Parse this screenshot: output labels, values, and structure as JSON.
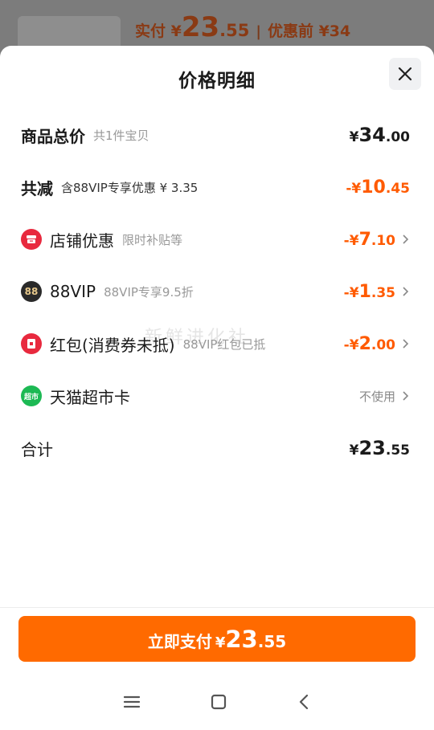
{
  "background": {
    "pay_label": "实付 ¥",
    "pay_int": "23",
    "pay_dec": ".55",
    "separator": "|",
    "before_label": "优惠前 ¥34"
  },
  "sheet": {
    "title": "价格明细"
  },
  "rows": {
    "total": {
      "label": "商品总价",
      "sub": "共1件宝贝",
      "cur": "¥",
      "int": "34",
      "dec": ".00"
    },
    "reduce": {
      "label": "共减",
      "sub": "含88VIP专享优惠 ¥ 3.35",
      "cur": "-¥",
      "int": "10",
      "dec": ".45"
    },
    "store": {
      "label": "店铺优惠",
      "sub": "限时补贴等",
      "cur": "-¥",
      "int": "7",
      "dec": ".10"
    },
    "vip": {
      "label": "88VIP",
      "sub": "88VIP专享9.5折",
      "cur": "-¥",
      "int": "1",
      "dec": ".35",
      "icon_text": "88"
    },
    "redpacket": {
      "label": "红包(消费券未抵)",
      "sub": "88VIP红包已抵",
      "cur": "-¥",
      "int": "2",
      "dec": ".00"
    },
    "supermarket": {
      "label": "天猫超市卡",
      "value": "不使用",
      "icon_text": "超市"
    },
    "sum": {
      "label": "合计",
      "cur": "¥",
      "int": "23",
      "dec": ".55"
    }
  },
  "watermark": "新鲜进化社",
  "pay_button": {
    "label": "立即支付",
    "cur": "¥",
    "int": "23",
    "dec": ".55"
  },
  "colors": {
    "accent": "#ff6a00",
    "discount": "#ff5a00",
    "store_icon": "#e8293e",
    "super_icon": "#1db954"
  }
}
